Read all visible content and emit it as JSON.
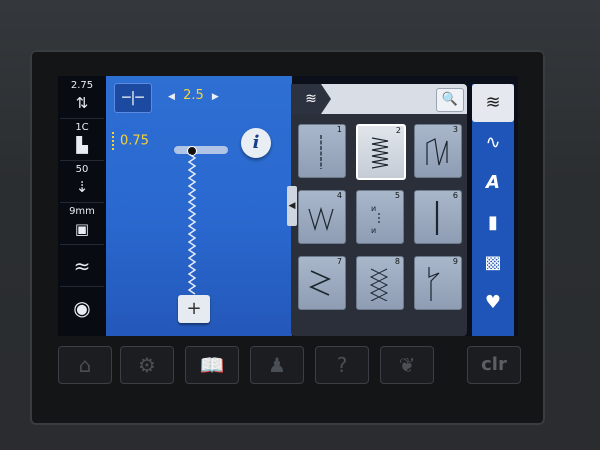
{
  "left_toolbar": {
    "items": [
      {
        "value": "2.75",
        "icon": "tension-icon",
        "glyph": "⇅"
      },
      {
        "value": "1C",
        "icon": "presser-foot-icon",
        "glyph": "▙"
      },
      {
        "value": "50",
        "icon": "presser-pressure-icon",
        "glyph": "⇣"
      },
      {
        "value": "9mm",
        "icon": "needle-plate-icon",
        "glyph": "▣"
      },
      {
        "value": "",
        "icon": "feed-dog-icon",
        "glyph": "≈"
      },
      {
        "value": "",
        "icon": "bobbin-icon",
        "glyph": "◉"
      }
    ]
  },
  "stitch_settings": {
    "needle_position_glyph": "─|─",
    "width_value": "2.5",
    "length_value": "0.75",
    "info_label": "i",
    "plus_label": "+"
  },
  "panel": {
    "category_glyph": "≋",
    "search_glyph": "🔍",
    "collapse_glyph": "◀",
    "stitches": [
      {
        "num": "1",
        "pattern": "straight",
        "selected": false
      },
      {
        "num": "2",
        "pattern": "zigzag-narrow",
        "selected": true
      },
      {
        "num": "3",
        "pattern": "vari-overlock",
        "selected": false
      },
      {
        "num": "4",
        "pattern": "running-stitch",
        "selected": false
      },
      {
        "num": "5",
        "pattern": "basting",
        "selected": false
      },
      {
        "num": "6",
        "pattern": "triple-straight",
        "selected": false
      },
      {
        "num": "7",
        "pattern": "triple-zigzag",
        "selected": false
      },
      {
        "num": "8",
        "pattern": "honeycomb",
        "selected": false
      },
      {
        "num": "9",
        "pattern": "blind-stitch",
        "selected": false
      }
    ]
  },
  "right_toolbar": {
    "items": [
      {
        "icon": "practical-stitches-icon",
        "glyph": "≋",
        "selected": true
      },
      {
        "icon": "decorative-stitches-icon",
        "glyph": "∿",
        "selected": false
      },
      {
        "icon": "alphabets-icon",
        "glyph": "A",
        "selected": false
      },
      {
        "icon": "buttonholes-icon",
        "glyph": "▮",
        "selected": false
      },
      {
        "icon": "quilt-stitches-icon",
        "glyph": "▩",
        "selected": false
      },
      {
        "icon": "personal-program-icon",
        "glyph": "♥",
        "selected": false
      }
    ]
  },
  "hardware_buttons": [
    {
      "icon": "home-icon",
      "glyph": "⌂"
    },
    {
      "icon": "setup-icon",
      "glyph": "⚙"
    },
    {
      "icon": "tutorial-icon",
      "glyph": "📖"
    },
    {
      "icon": "creative-consultant-icon",
      "glyph": "♟"
    },
    {
      "icon": "help-icon",
      "glyph": "?"
    },
    {
      "icon": "eco-icon",
      "glyph": "❦"
    },
    {
      "icon": "clear-icon",
      "label": "clr"
    }
  ]
}
